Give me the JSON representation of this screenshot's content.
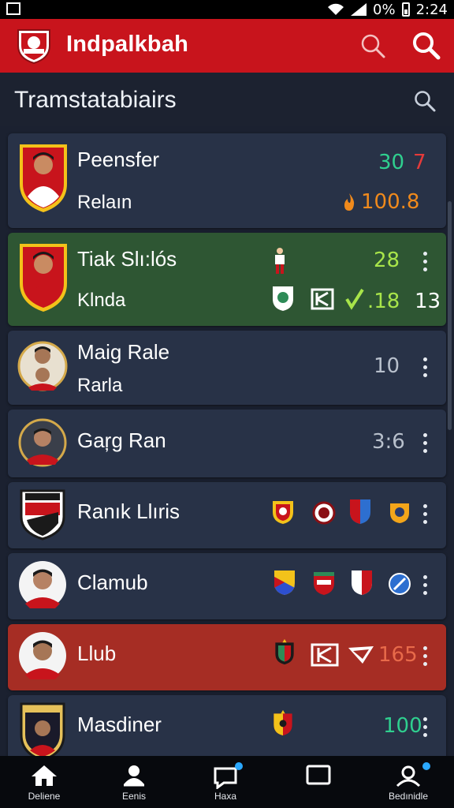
{
  "status_bar": {
    "battery_pct": "0%",
    "time": "2:24"
  },
  "app_bar": {
    "title": "Indpalkbah"
  },
  "subheader": {
    "title": "Tramstatabiairs"
  },
  "rows": [
    {
      "name": "Peensfer",
      "sub": "Relaın",
      "value_primary": "30",
      "value_primary_color": "#2fcf8f",
      "value_secondary": "7",
      "value_secondary_color": "#e53a3a",
      "value_sub": "100.8",
      "value_sub_color": "#f08a1c"
    },
    {
      "name": "Tiak Slı:lós",
      "sub": "Klnda",
      "value_primary": "28",
      "value_primary_color": "#a8e44a",
      "value_sub": ".18",
      "value_sub_color": "#a8e44a",
      "badge_text": "13"
    },
    {
      "name": "Maig Rale",
      "sub": "Rarla",
      "value_primary": "10",
      "value_primary_color": "#b8c0cc"
    },
    {
      "name": "Gaŗg Ran",
      "value_primary": "3:6",
      "value_primary_color": "#b8c0cc"
    },
    {
      "name": "Ranık Llıris"
    },
    {
      "name": "Clamub"
    },
    {
      "name": "Llub",
      "value_primary": "165",
      "value_primary_color": "#e86a4a"
    },
    {
      "name": "Masdiner",
      "value_primary": "100",
      "value_primary_color": "#2fcf8f"
    }
  ],
  "nav": [
    {
      "label": "Deliene",
      "icon": "home-icon"
    },
    {
      "label": "Eenis",
      "icon": "person-icon"
    },
    {
      "label": "Haxa",
      "icon": "chat-icon"
    },
    {
      "label": "",
      "icon": "square-icon"
    },
    {
      "label": "Bedınidle",
      "icon": "profile-icon"
    }
  ]
}
